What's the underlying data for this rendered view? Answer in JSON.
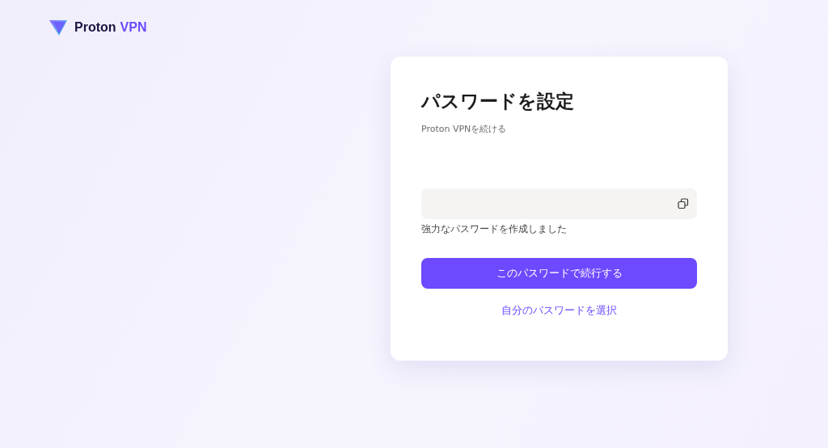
{
  "header": {
    "logo": {
      "brand": "Proton",
      "product": "VPN"
    }
  },
  "card": {
    "title": "パスワードを設定",
    "subtitle": "Proton VPNを続ける",
    "password_field": {
      "hint": "強力なパスワードを作成しました"
    },
    "primary_button": "このパスワードで続行する",
    "secondary_link": "自分のパスワードを選択"
  }
}
